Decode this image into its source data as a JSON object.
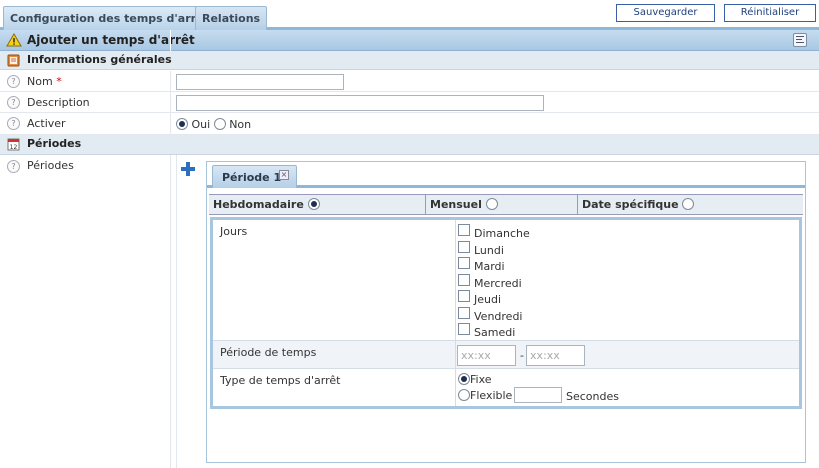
{
  "tabs": [
    {
      "label": "Configuration des temps d'arrêt",
      "active": true
    },
    {
      "label": "Relations",
      "active": false
    }
  ],
  "toolbar": {
    "save_label": "Sauvegarder",
    "reset_label": "Réinitialiser"
  },
  "header": {
    "title": "Ajouter un temps d'arrêt"
  },
  "general": {
    "title": "Informations générales",
    "name_label": "Nom",
    "required_mark": "*",
    "description_label": "Description",
    "active_label": "Activer",
    "active_yes": "Oui",
    "active_no": "Non",
    "active_value": "Oui"
  },
  "periods": {
    "title": "Périodes",
    "label": "Périodes",
    "tab_label": "Période 1",
    "modes": [
      "Hebdomadaire",
      "Mensuel",
      "Date spécifique"
    ],
    "selected_mode": "Hebdomadaire",
    "days_label": "Jours",
    "days": [
      "Dimanche",
      "Lundi",
      "Mardi",
      "Mercredi",
      "Jeudi",
      "Vendredi",
      "Samedi"
    ],
    "time_label": "Période de temps",
    "time_start_placeholder": "xx:xx",
    "time_separator": "-",
    "time_end_placeholder": "xx:xx",
    "type_label": "Type de temps d'arrêt",
    "type_fixed": "Fixe",
    "type_flexible": "Flexible",
    "type_selected": "Fixe",
    "seconds_label": "Secondes"
  },
  "colors": {
    "accent": "#8fb8d8",
    "header_band": "#b9d3ea",
    "required": "#dd0000",
    "plus_icon": "#2a6fc0"
  }
}
